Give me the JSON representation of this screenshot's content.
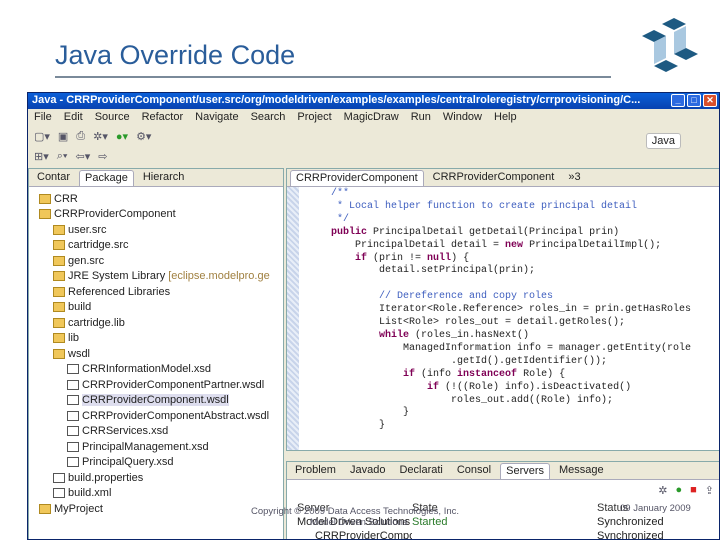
{
  "slide": {
    "title": "Java Override Code",
    "copyright": "Copyright © 2009 Data Access Technologies, Inc.",
    "company": "Model Driven Solutions",
    "date": "09 January 2009"
  },
  "window": {
    "title": "Java - CRRProviderComponent/user.src/org/modeldriven/examples/examples/centralroleregistry/crrprovisioning/C...",
    "menu": [
      "File",
      "Edit",
      "Source",
      "Refactor",
      "Navigate",
      "Search",
      "Project",
      "MagicDraw",
      "Run",
      "Window",
      "Help"
    ],
    "perspective": "Java"
  },
  "left_tabs": [
    "Contar",
    "Package",
    "Hierarch"
  ],
  "tree": [
    {
      "label": "CRR",
      "indent": 0,
      "icon": "project"
    },
    {
      "label": "CRRProviderComponent",
      "indent": 0,
      "icon": "project"
    },
    {
      "label": "user.src",
      "indent": 1,
      "icon": "src-folder"
    },
    {
      "label": "cartridge.src",
      "indent": 1,
      "icon": "src-folder"
    },
    {
      "label": "gen.src",
      "indent": 1,
      "icon": "src-folder"
    },
    {
      "label": "JRE System Library",
      "deco": "[eclipse.modelpro.ge",
      "indent": 1,
      "icon": "library"
    },
    {
      "label": "Referenced Libraries",
      "indent": 1,
      "icon": "library"
    },
    {
      "label": "build",
      "indent": 1,
      "icon": "folder"
    },
    {
      "label": "cartridge.lib",
      "indent": 1,
      "icon": "folder"
    },
    {
      "label": "lib",
      "indent": 1,
      "icon": "folder"
    },
    {
      "label": "wsdl",
      "indent": 1,
      "icon": "folder"
    },
    {
      "label": "CRRInformationModel.xsd",
      "indent": 2,
      "icon": "file"
    },
    {
      "label": "CRRProviderComponentPartner.wsdl",
      "indent": 2,
      "icon": "file"
    },
    {
      "label": "CRRProviderComponent.wsdl",
      "indent": 2,
      "icon": "file",
      "selected": true
    },
    {
      "label": "CRRProviderComponentAbstract.wsdl",
      "indent": 2,
      "icon": "file"
    },
    {
      "label": "CRRServices.xsd",
      "indent": 2,
      "icon": "file"
    },
    {
      "label": "PrincipalManagement.xsd",
      "indent": 2,
      "icon": "file"
    },
    {
      "label": "PrincipalQuery.xsd",
      "indent": 2,
      "icon": "file"
    },
    {
      "label": "build.properties",
      "indent": 1,
      "icon": "file"
    },
    {
      "label": "build.xml",
      "indent": 1,
      "icon": "file"
    },
    {
      "label": "MyProject",
      "indent": 0,
      "icon": "project"
    }
  ],
  "editor_tabs": [
    "CRRProviderComponent",
    "CRRProviderComponent",
    "»3"
  ],
  "bottom_tabs": [
    "Problem",
    "Javado",
    "Declarati",
    "Consol",
    "Servers",
    "Message"
  ],
  "servers": {
    "headers": [
      "Server",
      "State",
      "Status"
    ],
    "rows": [
      [
        "Model Driven Solutions == S",
        "Started",
        "Synchronized"
      ],
      [
        "CRRProviderComponent",
        "",
        "Synchronized"
      ]
    ]
  }
}
